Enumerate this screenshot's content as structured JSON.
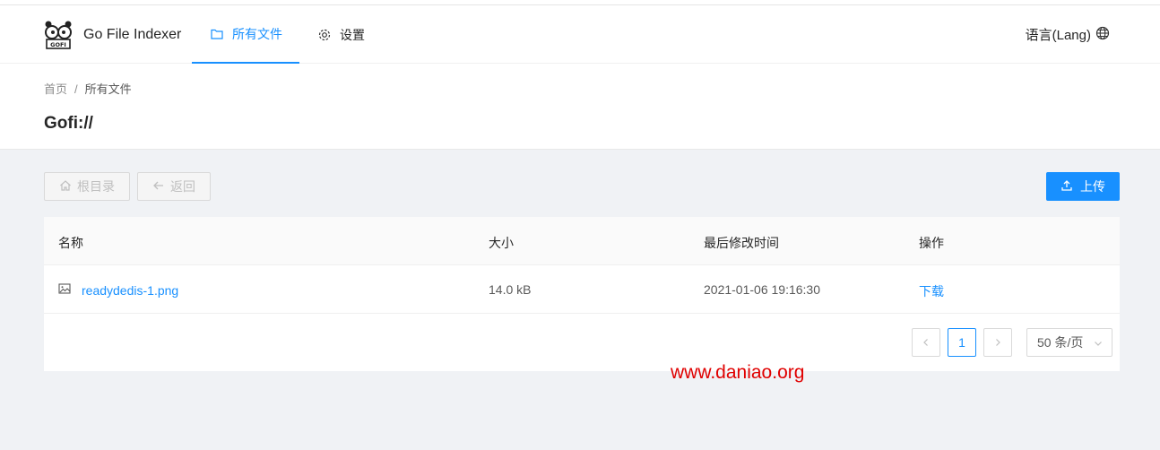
{
  "header": {
    "brand": "Go File Indexer",
    "logo_text": "GOFI",
    "nav": [
      {
        "label": "所有文件",
        "icon": "folder-icon",
        "active": true
      },
      {
        "label": "设置",
        "icon": "gear-icon",
        "active": false
      }
    ],
    "language": "语言(Lang)",
    "language_icon": "globe-icon"
  },
  "breadcrumb": {
    "home": "首页",
    "separator": "/",
    "current": "所有文件"
  },
  "page_title": "Gofi://",
  "toolbar": {
    "root_label": "根目录",
    "root_icon": "home-icon",
    "back_label": "返回",
    "back_icon": "arrow-left-icon",
    "upload_label": "上传",
    "upload_icon": "upload-icon"
  },
  "table": {
    "columns": [
      "名称",
      "大小",
      "最后修改时间",
      "操作"
    ],
    "rows": [
      {
        "name": "readydedis-1.png",
        "icon": "image-file-icon",
        "size": "14.0 kB",
        "modified": "2021-01-06 19:16:30",
        "action": "下载"
      }
    ]
  },
  "pagination": {
    "current_page": "1",
    "page_size": "50 条/页"
  },
  "watermark": "www.daniao.org",
  "colors": {
    "accent": "#1890ff",
    "watermark": "#e00000",
    "background": "#f0f2f5"
  }
}
